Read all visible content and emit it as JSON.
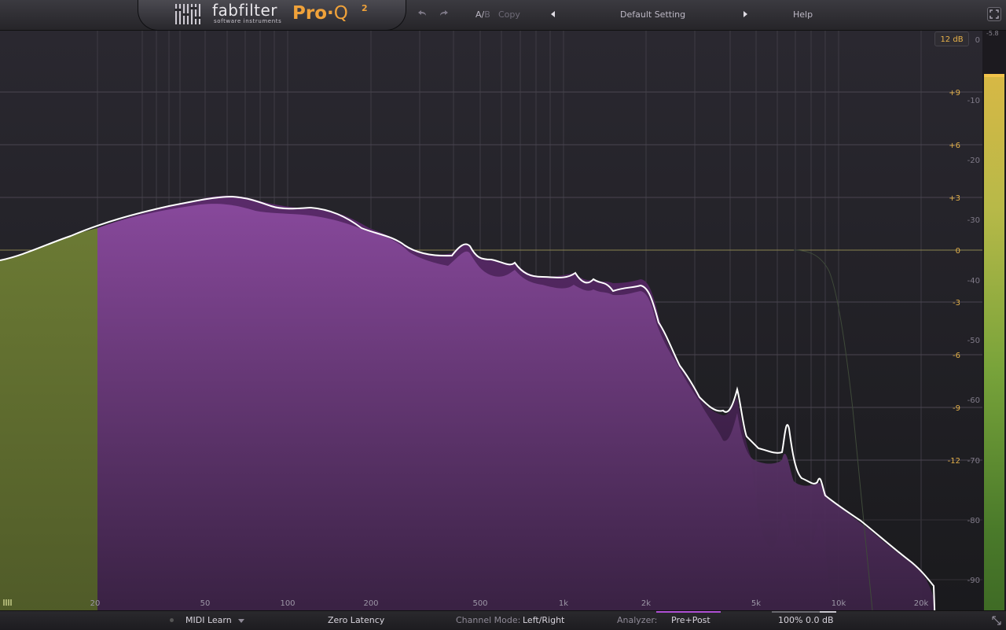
{
  "header": {
    "brand": "fabfilter",
    "brand_sub": "software instruments",
    "product": "Pro",
    "product_dot": "·",
    "product_q": "Q",
    "product_sup": "2",
    "ab_a": "A/",
    "ab_b": "B",
    "copy": "Copy",
    "preset": "Default Setting",
    "help": "Help"
  },
  "graph": {
    "range_button": "12 dB",
    "freq_labels": [
      "20",
      "50",
      "100",
      "200",
      "500",
      "1k",
      "2k",
      "5k",
      "10k",
      "20k"
    ],
    "gain_labels": [
      "+9",
      "+6",
      "+3",
      "0",
      "-3",
      "-6",
      "-9",
      "-12"
    ],
    "spectrum_labels": [
      "0",
      "-10",
      "-20",
      "-30",
      "-40",
      "-50",
      "-60",
      "-70",
      "-80",
      "-90"
    ],
    "meter_top": "-5.8",
    "colors": {
      "spectrum_fill": "#7a3f8f",
      "eq_curve": "#ffffff",
      "band_fill": "#5e6a2c",
      "gain_label": "#e3b04a",
      "meter_peak": "#f2c34a"
    }
  },
  "bottom": {
    "midi_learn": "MIDI Learn",
    "latency": "Zero Latency",
    "channel_mode_label": "Channel Mode:",
    "channel_mode_value": "Left/Right",
    "analyzer_label": "Analyzer:",
    "analyzer_value": "Pre+Post",
    "zoom": "100%",
    "output_gain": "0.0 dB"
  }
}
